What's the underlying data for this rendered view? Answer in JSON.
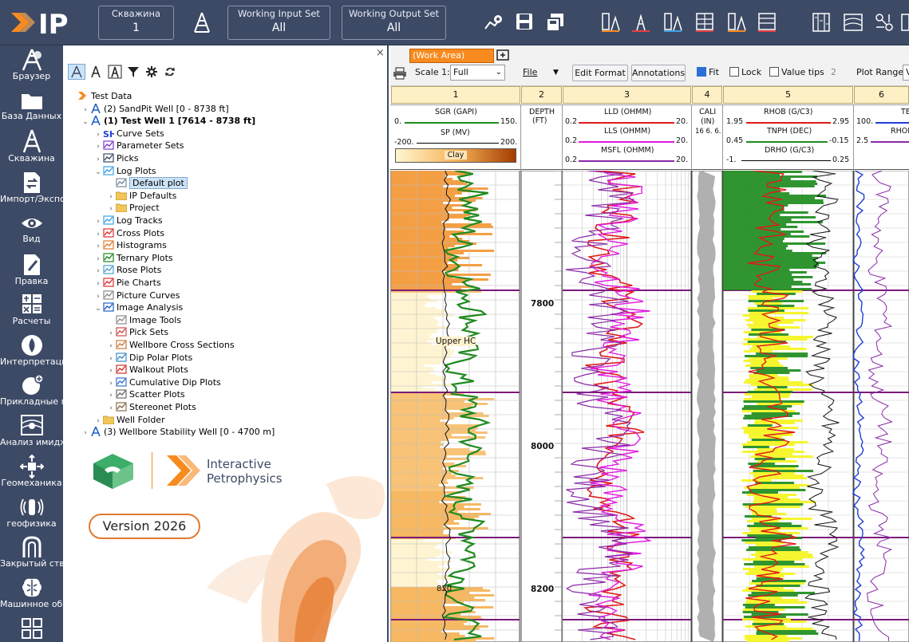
{
  "app": {
    "logo_text": "IP"
  },
  "topbar": {
    "well_label": "Скважина",
    "well_value": "1",
    "input_set_label": "Working Input Set",
    "input_set_value": "All",
    "output_set_label": "Working Output Set",
    "output_set_value": "All"
  },
  "sidebar": {
    "items": [
      {
        "label": "Браузер",
        "icon": "browser-icon"
      },
      {
        "label": "База Данных",
        "icon": "folder-icon"
      },
      {
        "label": "Скважина",
        "icon": "well-icon"
      },
      {
        "label": "Импорт/Экспорт",
        "icon": "import-icon"
      },
      {
        "label": "Вид",
        "icon": "eye-icon"
      },
      {
        "label": "Правка",
        "icon": "edit-icon"
      },
      {
        "label": "Расчеты",
        "icon": "calc-icon"
      },
      {
        "label": "Интерпретация",
        "icon": "drop-icon"
      },
      {
        "label": "Прикладные модули",
        "icon": "modules-icon"
      },
      {
        "label": "Анализ имиджей",
        "icon": "image-analysis-icon"
      },
      {
        "label": "Геомеханика",
        "icon": "geomech-icon"
      },
      {
        "label": "геофизика",
        "icon": "geophysics-icon"
      },
      {
        "label": "Закрытый ствол",
        "icon": "cased-hole-icon"
      },
      {
        "label": "Машинное обучение",
        "icon": "brain-icon"
      }
    ]
  },
  "tree": {
    "close": "×",
    "nodes": [
      {
        "label": "Test Data",
        "level": 0,
        "expander": "",
        "icon": "data-icon"
      },
      {
        "label": "(2) SandPit Well [0 - 8738 ft]",
        "level": 1,
        "expander": "›",
        "icon": "well-icon"
      },
      {
        "label": "(1) Test Well 1 [7614 - 8738 ft]",
        "level": 1,
        "expander": "⌄",
        "icon": "well-icon",
        "bold": true
      },
      {
        "label": "Curve Sets",
        "level": 2,
        "expander": "›",
        "icon": "curve-sets-icon"
      },
      {
        "label": "Parameter Sets",
        "level": 2,
        "expander": "›",
        "icon": "parameter-sets-icon"
      },
      {
        "label": "Picks",
        "level": 2,
        "expander": "›",
        "icon": "picks-icon"
      },
      {
        "label": "Log Plots",
        "level": 2,
        "expander": "⌄",
        "icon": "log-plots-icon"
      },
      {
        "label": "Default plot",
        "level": 3,
        "expander": "",
        "icon": "plot-icon",
        "selected": true
      },
      {
        "label": "IP Defaults",
        "level": 3,
        "expander": "›",
        "icon": "folder-icon"
      },
      {
        "label": "Project",
        "level": 3,
        "expander": "›",
        "icon": "folder-icon"
      },
      {
        "label": "Log Tracks",
        "level": 2,
        "expander": "›",
        "icon": "log-tracks-icon"
      },
      {
        "label": "Cross Plots",
        "level": 2,
        "expander": "›",
        "icon": "cross-plots-icon"
      },
      {
        "label": "Histograms",
        "level": 2,
        "expander": "›",
        "icon": "histogram-icon"
      },
      {
        "label": "Ternary Plots",
        "level": 2,
        "expander": "›",
        "icon": "ternary-icon"
      },
      {
        "label": "Rose Plots",
        "level": 2,
        "expander": "›",
        "icon": "rose-icon"
      },
      {
        "label": "Pie Charts",
        "level": 2,
        "expander": "›",
        "icon": "pie-icon"
      },
      {
        "label": "Picture Curves",
        "level": 2,
        "expander": "›",
        "icon": "picture-icon"
      },
      {
        "label": "Image Analysis",
        "level": 2,
        "expander": "⌄",
        "icon": "image-analysis-icon"
      },
      {
        "label": "Image Tools",
        "level": 3,
        "expander": "",
        "icon": "tools-icon"
      },
      {
        "label": "Pick Sets",
        "level": 3,
        "expander": "›",
        "icon": "pick-sets-icon"
      },
      {
        "label": "Wellbore Cross Sections",
        "level": 3,
        "expander": "›",
        "icon": "cross-section-icon"
      },
      {
        "label": "Dip Polar Plots",
        "level": 3,
        "expander": "›",
        "icon": "dip-polar-icon"
      },
      {
        "label": "Walkout Plots",
        "level": 3,
        "expander": "›",
        "icon": "walkout-icon"
      },
      {
        "label": "Cumulative Dip Plots",
        "level": 3,
        "expander": "›",
        "icon": "cum-dip-icon"
      },
      {
        "label": "Scatter Plots",
        "level": 3,
        "expander": "›",
        "icon": "scatter-icon"
      },
      {
        "label": "Stereonet Plots",
        "level": 3,
        "expander": "›",
        "icon": "stereonet-icon"
      },
      {
        "label": "Well Folder",
        "level": 2,
        "expander": "›",
        "icon": "folder-icon"
      },
      {
        "label": "(3) Wellbore Stability Well [0 - 4700 m]",
        "level": 1,
        "expander": "›",
        "icon": "well-icon"
      }
    ]
  },
  "splash": {
    "brand_line1": "Interactive",
    "brand_line2": "Petrophysics",
    "version": "Version 2026"
  },
  "plot": {
    "work_area_tab": "(Work Area)",
    "scale_label": "Scale 1:",
    "scale_value": "Full",
    "file_menu": "File",
    "edit_format": "Edit Format",
    "annotations": "Annotations",
    "fit_label": "Fit",
    "fit_checked": true,
    "lock_label": "Lock",
    "lock_checked": false,
    "value_tips_label": "Value tips",
    "value_tips_checked": false,
    "value_tips_num": "2",
    "plot_range_label": "Plot Range",
    "plot_range_value": "V",
    "tracks": [
      {
        "num": "1"
      },
      {
        "num": "2"
      },
      {
        "num": "3"
      },
      {
        "num": "4"
      },
      {
        "num": "5"
      },
      {
        "num": "6"
      }
    ],
    "track1": {
      "sgr": "SGR (GAPI)",
      "sgr_min": "0.",
      "sgr_max": "150.",
      "sp": "SP (MV)",
      "sp_min": "-200.",
      "sp_max": "200.",
      "clay": "Clay",
      "zone_label": "Upper HC",
      "depth_annot": "820"
    },
    "track2": {
      "depth": "DEPTH",
      "unit": "(FT)",
      "ticks": [
        "7800",
        "8000",
        "8200"
      ]
    },
    "track3": {
      "lld": "LLD (OHMM)",
      "lld_min": "0.2",
      "lld_max": "20.",
      "lls": "LLS (OHMM)",
      "lls_min": "0.2",
      "lls_max": "20.",
      "msfl": "MSFL (OHMM)",
      "msfl_min": "0.2",
      "msfl_max": "20."
    },
    "track4": {
      "cali": "CALI",
      "unit": "(IN)",
      "range": "16 6. 6."
    },
    "track5": {
      "rhob": "RHOB (G/C3)",
      "rhob_min": "1.95",
      "rhob_max": "2.95",
      "tnph": "TNPH (DEC)",
      "tnph_min": "0.45",
      "tnph_max": "-0.15",
      "drho": "DRHO (G/C3)",
      "drho_min": "-1.",
      "drho_max": "0.25"
    },
    "track6": {
      "h1": "TE",
      "h1_min": "100.",
      "h2": "RHOM",
      "h2_min": "2.5"
    }
  }
}
